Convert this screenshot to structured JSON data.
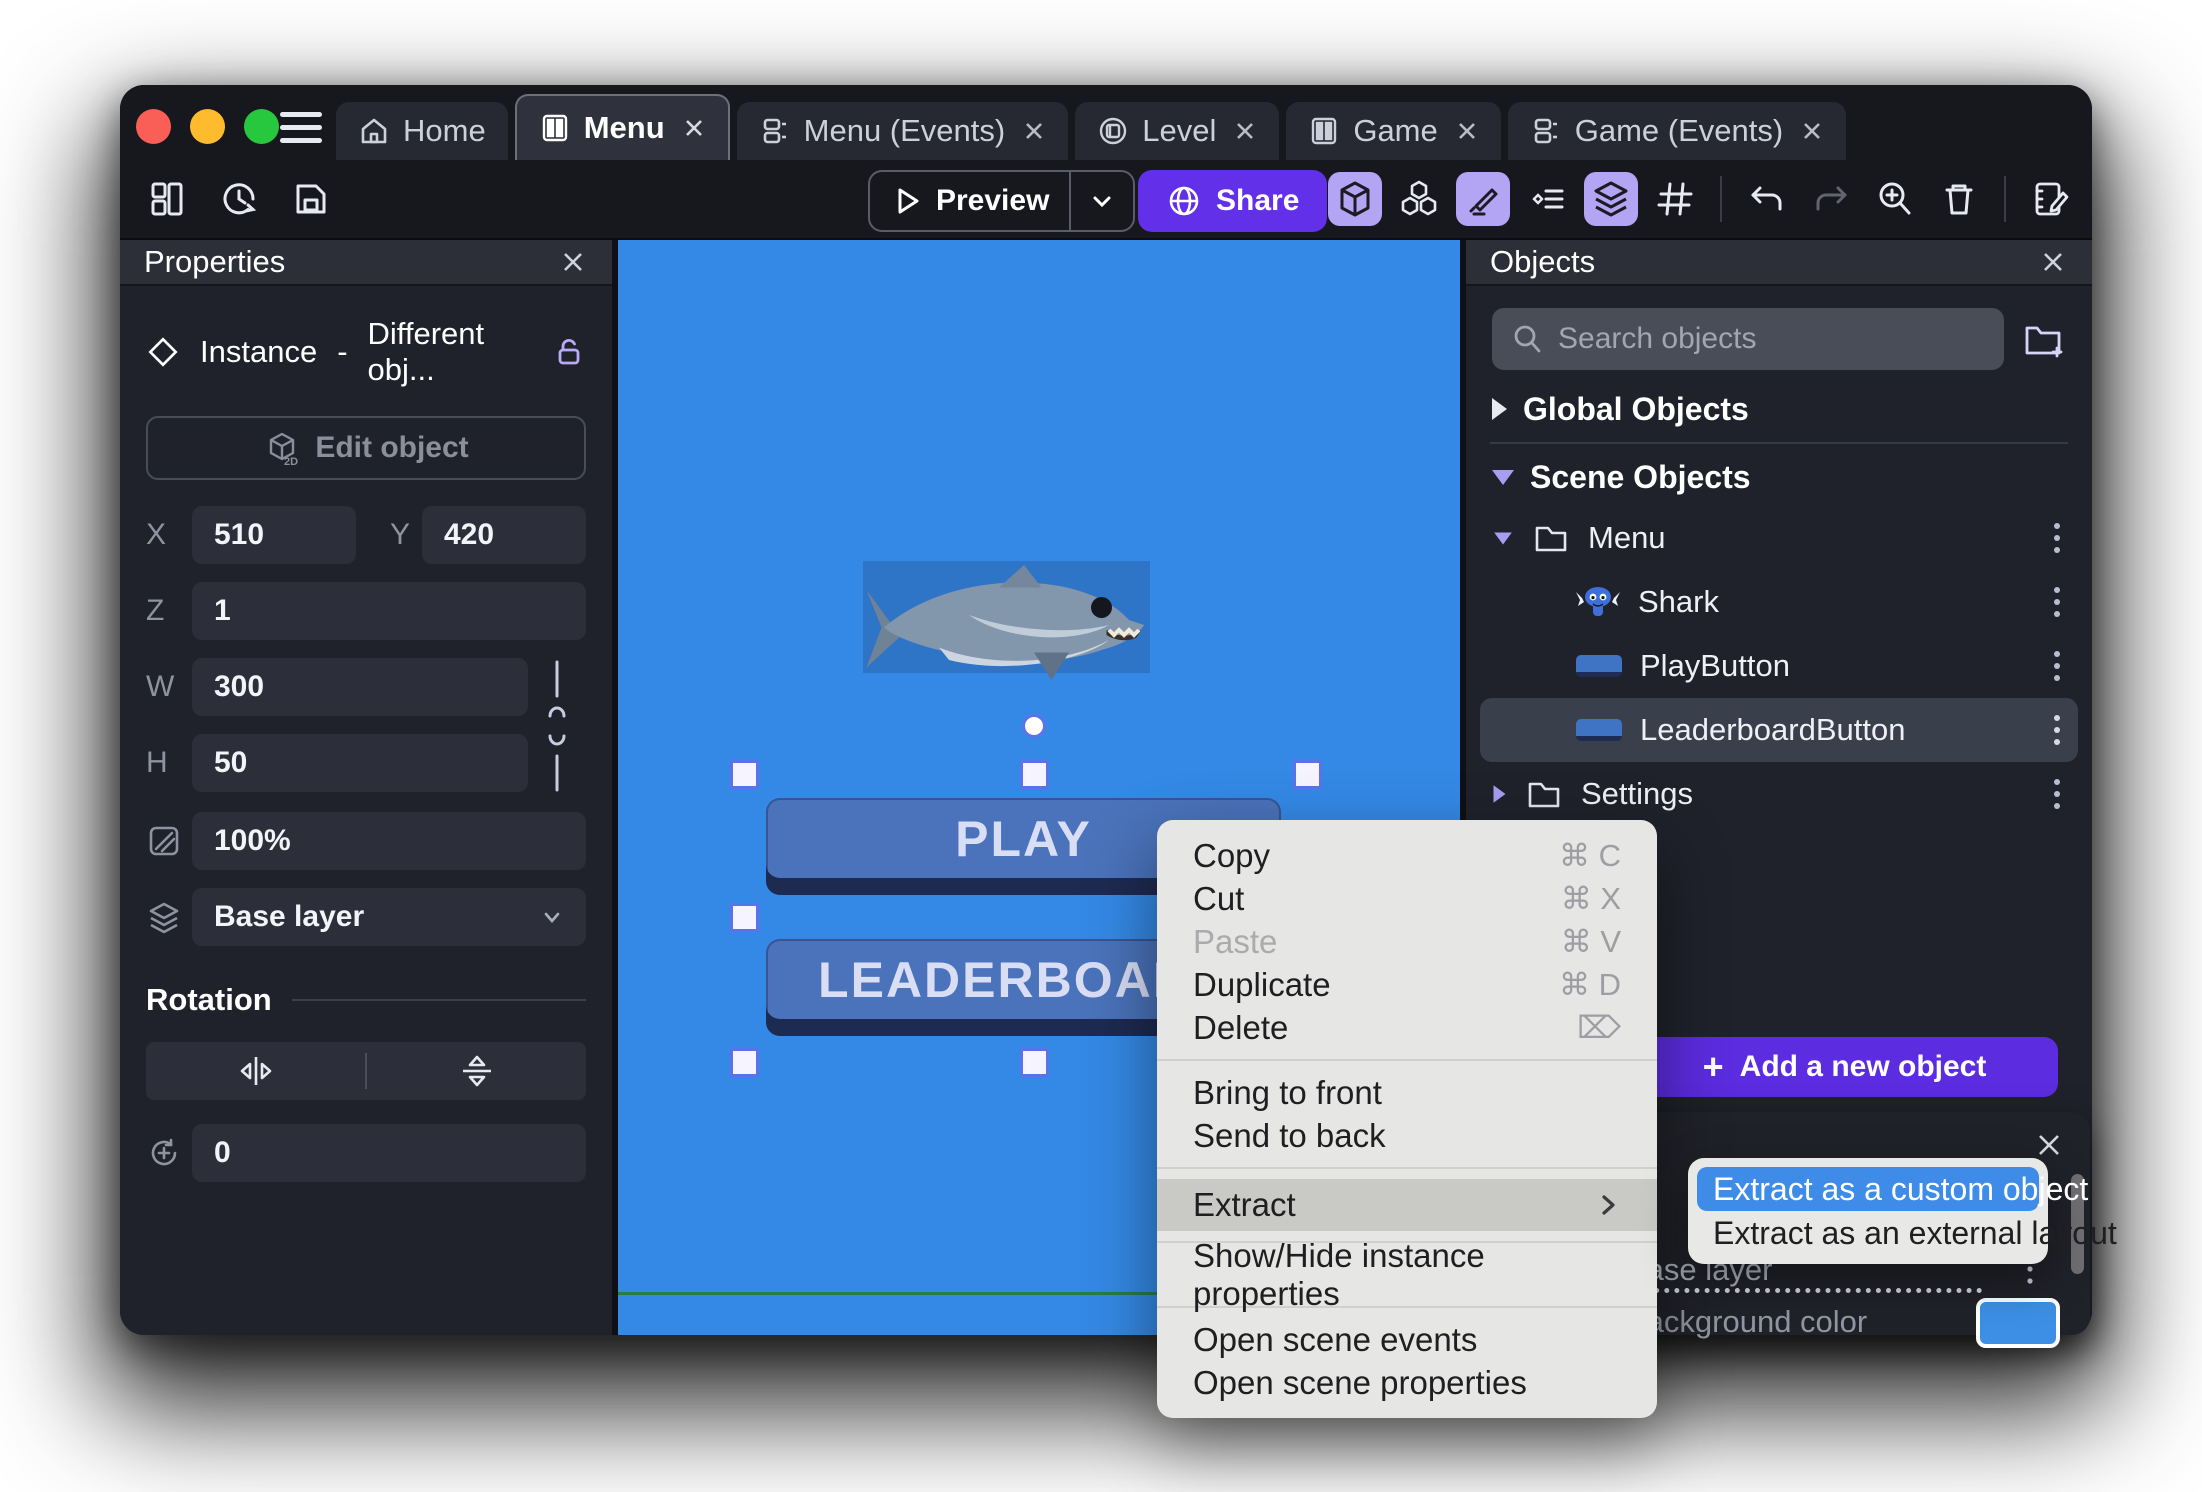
{
  "window": {
    "traffic_lights": [
      "#f95f57",
      "#fdbb2d",
      "#28c83e"
    ],
    "tabs": [
      {
        "label": "Home",
        "icon": "home-icon",
        "closable": false,
        "active": false
      },
      {
        "label": "Menu",
        "icon": "scene-icon",
        "closable": true,
        "active": true
      },
      {
        "label": "Menu (Events)",
        "icon": "events-icon",
        "closable": true,
        "active": false
      },
      {
        "label": "Level",
        "icon": "level-icon",
        "closable": true,
        "active": false
      },
      {
        "label": "Game",
        "icon": "scene-icon",
        "closable": true,
        "active": false
      },
      {
        "label": "Game (Events)",
        "icon": "events-icon",
        "closable": true,
        "active": false
      }
    ]
  },
  "toolbar": {
    "preview": "Preview",
    "share": "Share",
    "accent_purple": "#6130e8",
    "active_icon_bg": "#b4a4f4"
  },
  "properties": {
    "title": "Properties",
    "instance_label": "Instance",
    "separator": "-",
    "object_label": "Different obj...",
    "edit_object": "Edit object",
    "edit_badge": "2D",
    "x_label": "X",
    "x": "510",
    "y_label": "Y",
    "y": "420",
    "z_label": "Z",
    "z": "1",
    "w_label": "W",
    "w": "300",
    "h_label": "H",
    "h": "50",
    "opacity": "100%",
    "layer": "Base layer",
    "rotation_title": "Rotation",
    "rotation": "0"
  },
  "canvas": {
    "play": "PLAY",
    "leaderboard": "LEADERBOARD",
    "bg_color": "#3489e6",
    "button_color": "#4a73bb",
    "button_shadow_color": "#1d2a52",
    "guide_line_color": "#2c7a4b"
  },
  "objects": {
    "title": "Objects",
    "search_placeholder": "Search objects",
    "global": "Global Objects",
    "scene": "Scene Objects",
    "tree": [
      {
        "label": "Menu",
        "type": "folder",
        "expanded": true
      },
      {
        "label": "Shark",
        "type": "sprite"
      },
      {
        "label": "PlayButton",
        "type": "button"
      },
      {
        "label": "LeaderboardButton",
        "type": "button",
        "selected": true
      },
      {
        "label": "Settings",
        "type": "folder",
        "expanded": false
      }
    ],
    "add_plus": "+",
    "add_button": "Add a new object"
  },
  "context_menu": {
    "items": [
      {
        "label": "Copy",
        "shortcut": "⌘ C"
      },
      {
        "label": "Cut",
        "shortcut": "⌘ X"
      },
      {
        "label": "Paste",
        "shortcut": "⌘ V",
        "disabled": true
      },
      {
        "label": "Duplicate",
        "shortcut": "⌘ D"
      },
      {
        "label": "Delete",
        "shortcut": "⌦"
      },
      {
        "label": "Bring to front"
      },
      {
        "label": "Send to back"
      },
      {
        "label": "Extract",
        "submenu": true,
        "highlighted": true
      },
      {
        "label": "Show/Hide instance properties"
      },
      {
        "label": "Open scene events"
      },
      {
        "label": "Open scene properties"
      }
    ]
  },
  "submenu": {
    "highlight_color": "#3f8ce8",
    "items": [
      {
        "label": "Extract as a custom object",
        "highlighted": true
      },
      {
        "label": "Extract as an external layout"
      }
    ]
  },
  "layers_panel": {
    "layer": "Base layer",
    "color_label": "Background color",
    "swatch_color": "#3c8fe4"
  }
}
